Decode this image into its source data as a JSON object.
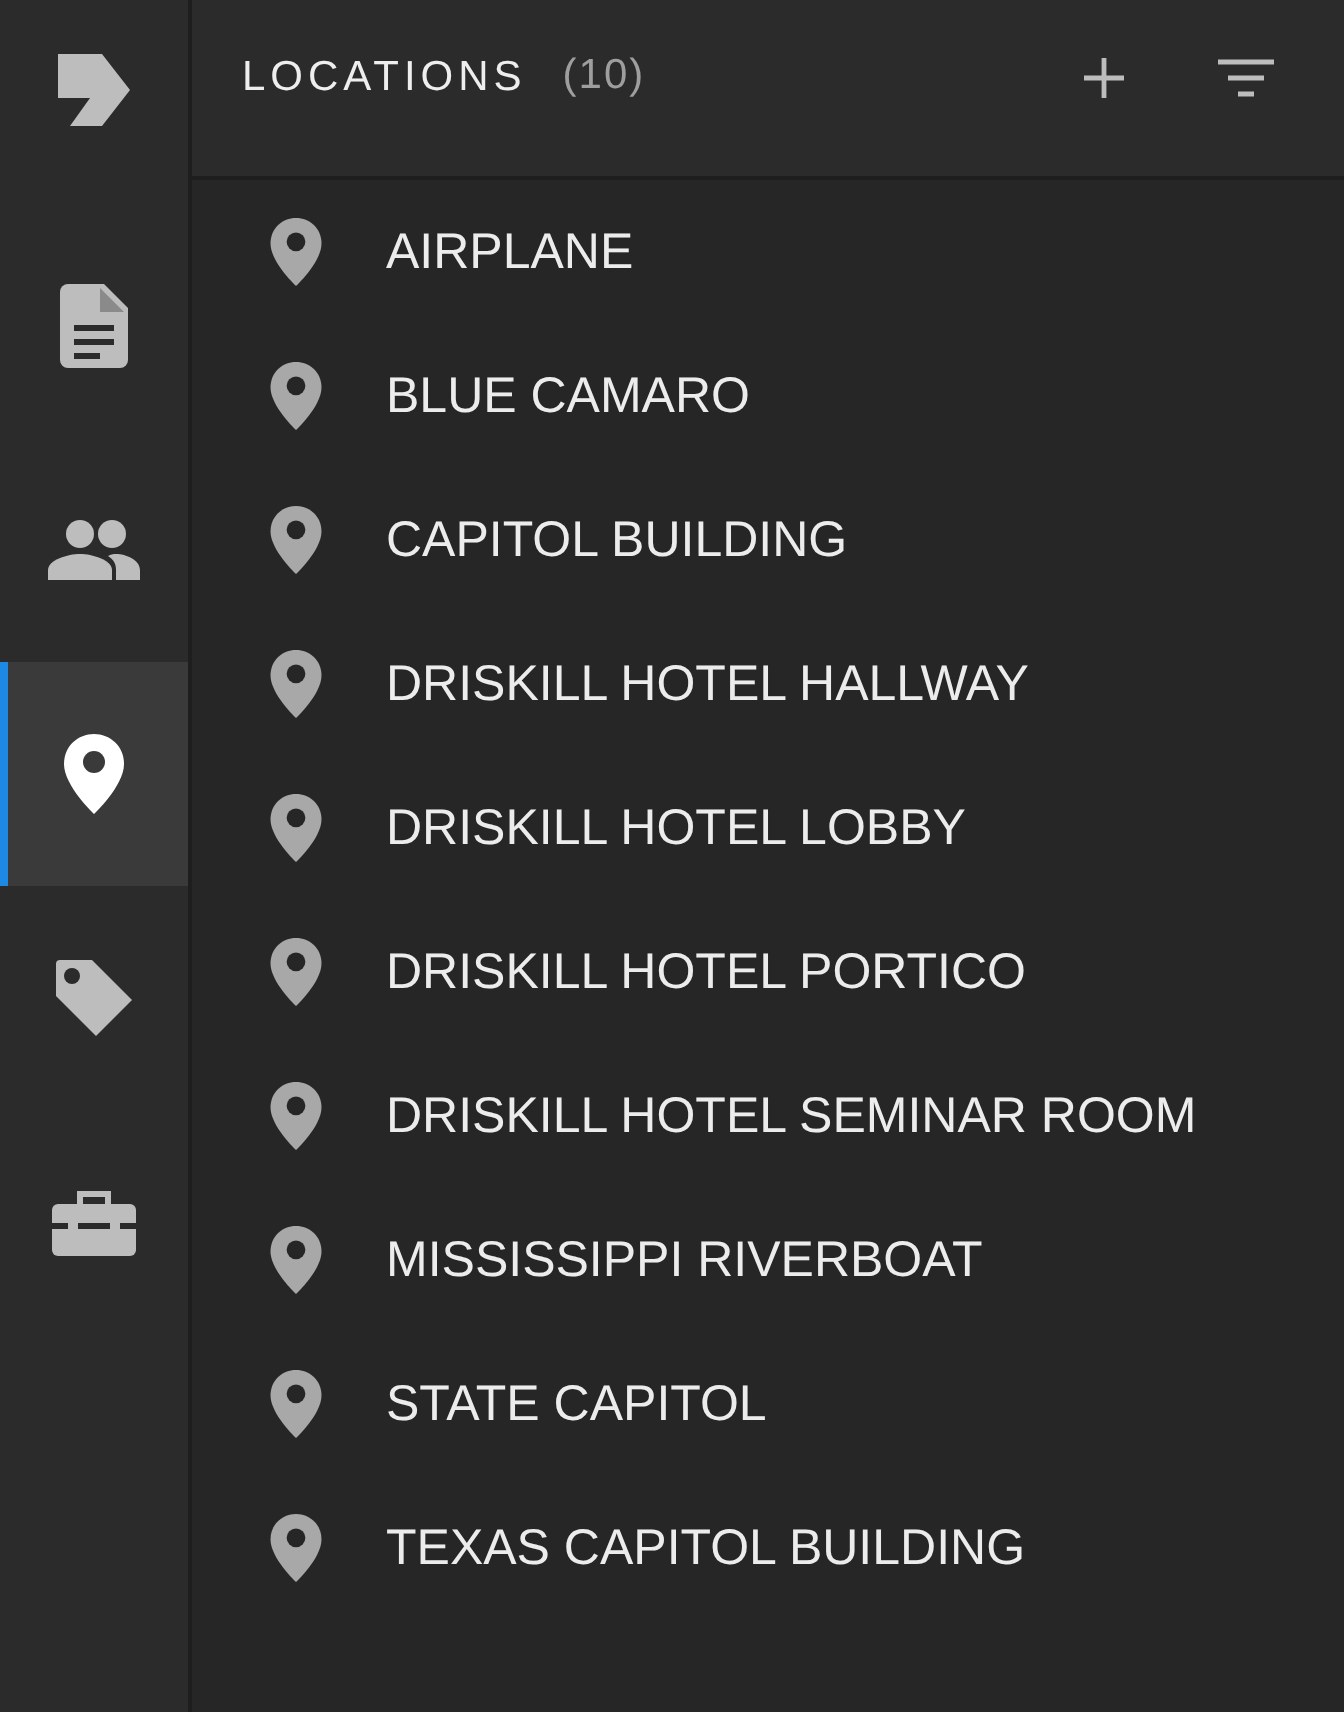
{
  "sidebar": {
    "items": [
      {
        "kind": "document",
        "selected": false
      },
      {
        "kind": "people",
        "selected": false
      },
      {
        "kind": "pin",
        "selected": true
      },
      {
        "kind": "tag",
        "selected": false
      },
      {
        "kind": "toolbox",
        "selected": false
      }
    ]
  },
  "header": {
    "title": "LOCATIONS",
    "count": "(10)"
  },
  "locations": [
    {
      "name": "AIRPLANE"
    },
    {
      "name": "BLUE CAMARO"
    },
    {
      "name": "CAPITOL BUILDING"
    },
    {
      "name": "DRISKILL HOTEL HALLWAY"
    },
    {
      "name": "DRISKILL HOTEL LOBBY"
    },
    {
      "name": "DRISKILL HOTEL PORTICO"
    },
    {
      "name": "DRISKILL HOTEL SEMINAR ROOM"
    },
    {
      "name": "MISSISSIPPI RIVERBOAT"
    },
    {
      "name": "STATE CAPITOL"
    },
    {
      "name": "TEXAS CAPITOL BUILDING"
    }
  ]
}
